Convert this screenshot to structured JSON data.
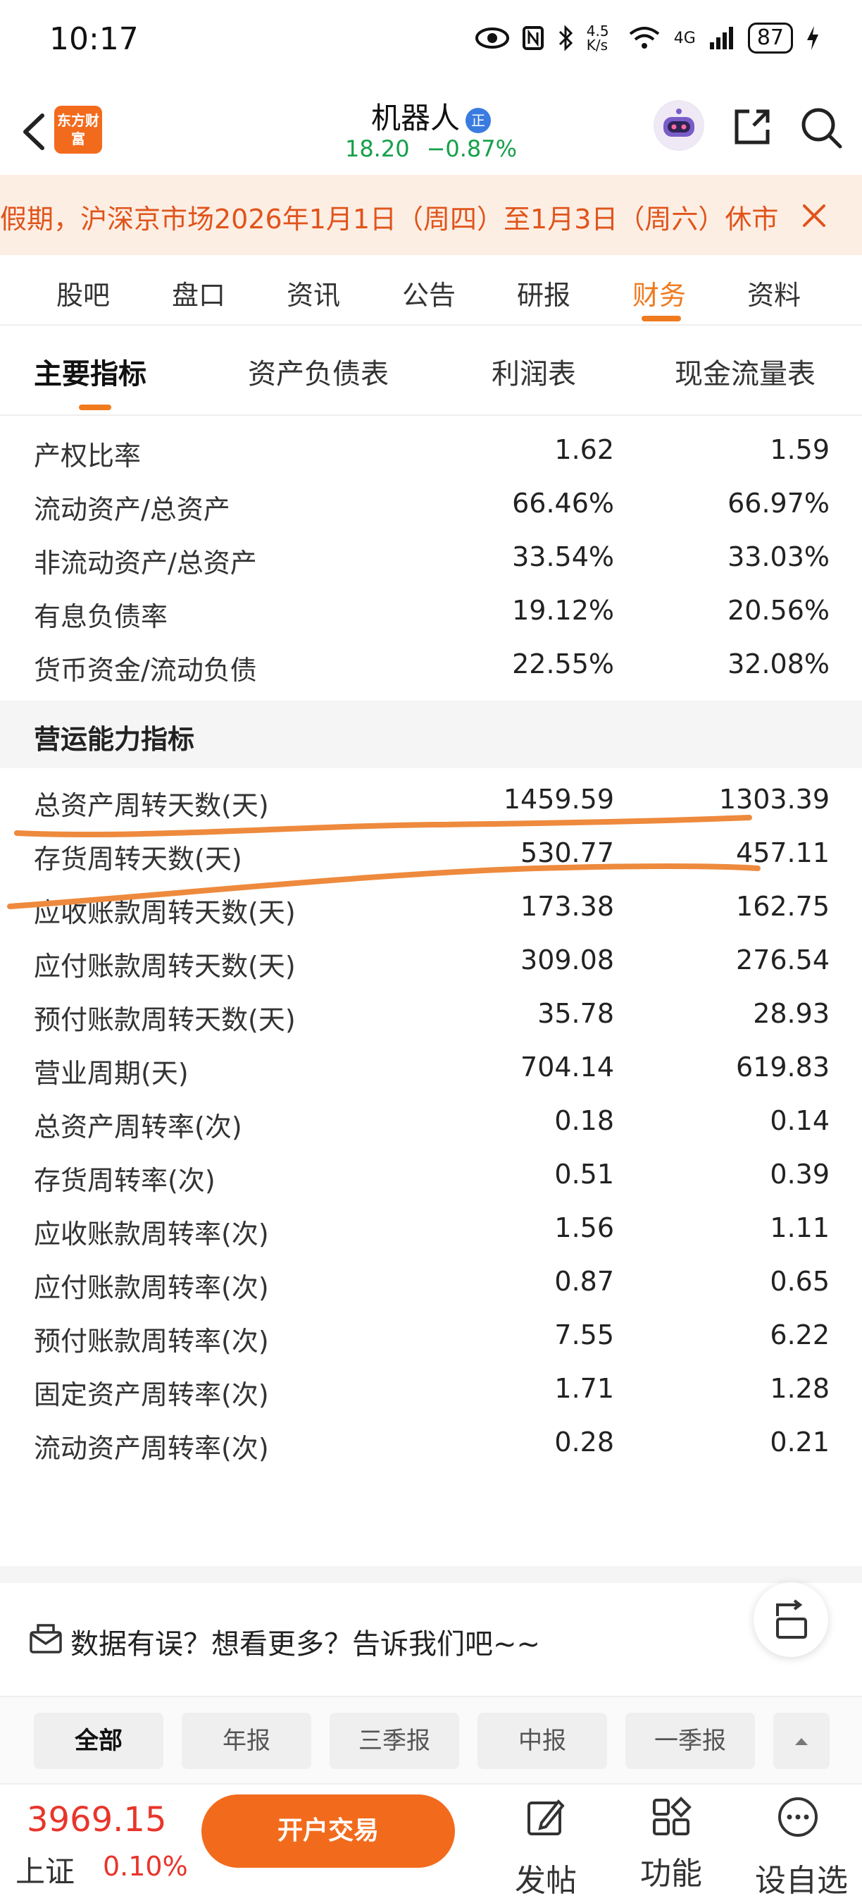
{
  "status_bar": {
    "time": "10:17",
    "net_speed": "4.5 K/s",
    "network": "4G",
    "battery": "87"
  },
  "header": {
    "logo_text": "东方财富",
    "stock_name": "机器人",
    "stock_badge": "正",
    "price": "18.20",
    "change_pct": "−0.87%"
  },
  "notice": {
    "text": "假期，沪深京市场2026年1月1日（周四）至1月3日（周六）休市"
  },
  "main_tabs": [
    "股吧",
    "盘口",
    "资讯",
    "公告",
    "研报",
    "财务",
    "资料"
  ],
  "main_tab_active": "财务",
  "sub_tabs": [
    "主要指标",
    "资产负债表",
    "利润表",
    "现金流量表"
  ],
  "sub_tab_active": "主要指标",
  "debt_rows": [
    {
      "label": "产权比率",
      "v1": "1.62",
      "v2": "1.59"
    },
    {
      "label": "流动资产/总资产",
      "v1": "66.46%",
      "v2": "66.97%"
    },
    {
      "label": "非流动资产/总资产",
      "v1": "33.54%",
      "v2": "33.03%"
    },
    {
      "label": "有息负债率",
      "v1": "19.12%",
      "v2": "20.56%"
    },
    {
      "label": "货币资金/流动负债",
      "v1": "22.55%",
      "v2": "32.08%"
    }
  ],
  "section_title": "营运能力指标",
  "ops_rows": [
    {
      "label": "总资产周转天数(天)",
      "v1": "1459.59",
      "v2": "1303.39"
    },
    {
      "label": "存货周转天数(天)",
      "v1": "530.77",
      "v2": "457.11"
    },
    {
      "label": "应收账款周转天数(天)",
      "v1": "173.38",
      "v2": "162.75"
    },
    {
      "label": "应付账款周转天数(天)",
      "v1": "309.08",
      "v2": "276.54"
    },
    {
      "label": "预付账款周转天数(天)",
      "v1": "35.78",
      "v2": "28.93"
    },
    {
      "label": "营业周期(天)",
      "v1": "704.14",
      "v2": "619.83"
    },
    {
      "label": "总资产周转率(次)",
      "v1": "0.18",
      "v2": "0.14"
    },
    {
      "label": "存货周转率(次)",
      "v1": "0.51",
      "v2": "0.39"
    },
    {
      "label": "应收账款周转率(次)",
      "v1": "1.56",
      "v2": "1.11"
    },
    {
      "label": "应付账款周转率(次)",
      "v1": "0.87",
      "v2": "0.65"
    },
    {
      "label": "预付账款周转率(次)",
      "v1": "7.55",
      "v2": "6.22"
    },
    {
      "label": "固定资产周转率(次)",
      "v1": "1.71",
      "v2": "1.28"
    },
    {
      "label": "流动资产周转率(次)",
      "v1": "0.28",
      "v2": "0.21"
    }
  ],
  "feedback": {
    "text": "数据有误？想看更多？告诉我们吧~~"
  },
  "filters": [
    "全部",
    "年报",
    "三季报",
    "中报",
    "一季报"
  ],
  "filter_active": "全部",
  "bottom": {
    "index_value": "3969.15",
    "index_name": "上证",
    "index_change": "0.10%",
    "trade_button": "开户交易",
    "post_label": "发帖",
    "function_label": "功能",
    "watchlist_label": "设自选"
  },
  "colors": {
    "accent": "#f07a1e",
    "brand": "#f26b1d",
    "down": "#15a04a",
    "up": "#e8352b",
    "annotation": "#ee8a3d"
  }
}
